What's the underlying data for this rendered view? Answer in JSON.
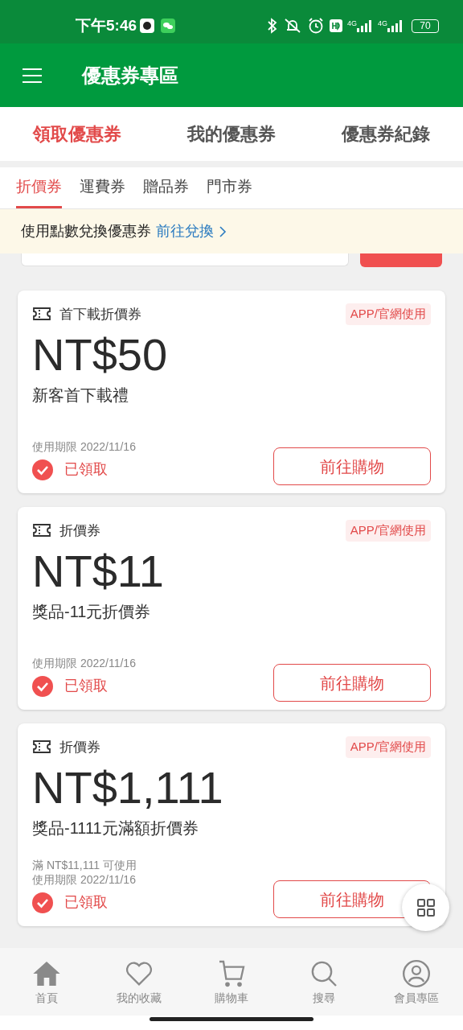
{
  "status_bar": {
    "time": "下午5:46",
    "network": [
      "4G",
      "4G"
    ],
    "battery": "70"
  },
  "app_bar": {
    "title": "優惠券專區"
  },
  "tabs": [
    {
      "label": "領取優惠券",
      "selected": true
    },
    {
      "label": "我的優惠券",
      "selected": false
    },
    {
      "label": "優惠券紀錄",
      "selected": false
    }
  ],
  "sub_tabs": [
    {
      "label": "折價券",
      "selected": true
    },
    {
      "label": "運費券",
      "selected": false
    },
    {
      "label": "贈品券",
      "selected": false
    },
    {
      "label": "門市券",
      "selected": false
    }
  ],
  "banner": {
    "text": "使用點數兌換優惠券",
    "link": "前往兌換"
  },
  "coupons": [
    {
      "type": "首下載折價券",
      "badge": "APP/官網使用",
      "amount": "NT$50",
      "name": "新客首下載禮",
      "expiry": "使用期限 2022/11/16",
      "claimed": true,
      "status": "已領取",
      "button": "前往購物"
    },
    {
      "type": "折價券",
      "badge": "APP/官網使用",
      "amount": "NT$11",
      "name": "獎品-11元折價券",
      "expiry": "使用期限 2022/11/16",
      "claimed": true,
      "status": "已領取",
      "button": "前往購物"
    },
    {
      "type": "折價券",
      "badge": "APP/官網使用",
      "amount": "NT$1,111",
      "name": "獎品-1111元滿額折價券",
      "condition": "滿 NT$11,111 可使用",
      "expiry": "使用期限 2022/11/16",
      "claimed": true,
      "status": "已領取",
      "button": "前往購物"
    }
  ],
  "bottom_nav": [
    {
      "kind": "home",
      "label": "首頁"
    },
    {
      "kind": "heart",
      "label": "我的收藏"
    },
    {
      "kind": "cart",
      "label": "購物車"
    },
    {
      "kind": "search",
      "label": "搜尋"
    },
    {
      "kind": "user",
      "label": "會員專區"
    }
  ]
}
